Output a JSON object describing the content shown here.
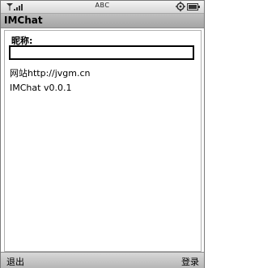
{
  "status_bar": {
    "input_mode": "ABC",
    "signal_icon": "signal-strength-icon",
    "settings_icon": "gear-icon",
    "battery_icon": "battery-icon"
  },
  "app": {
    "title": "IMChat"
  },
  "form": {
    "nickname_label": "昵称:",
    "nickname_value": ""
  },
  "info": {
    "website": "网站http://jvgm.cn",
    "version": "IMChat v0.0.1"
  },
  "softkeys": {
    "left": "退出",
    "right": "登录"
  }
}
